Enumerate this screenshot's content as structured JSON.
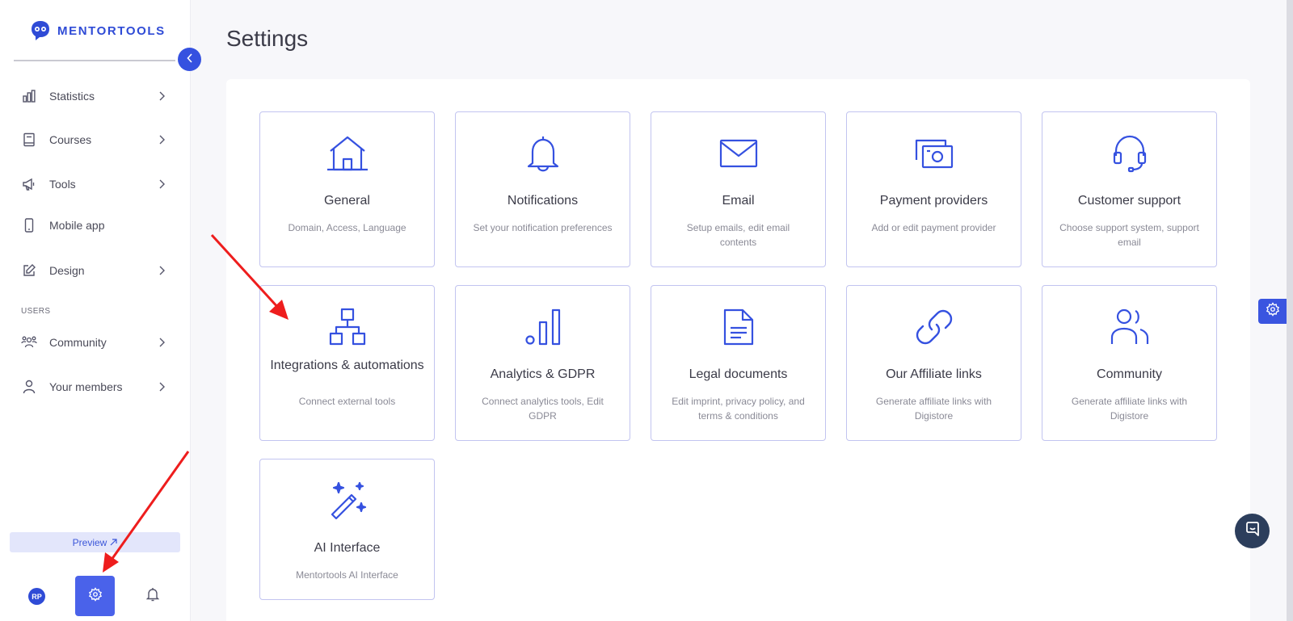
{
  "brand": {
    "name": "MENTORTOOLS",
    "accent": "#2f4bd6",
    "card_border": "#c2c4f0"
  },
  "sidebar": {
    "items": [
      {
        "label": "Statistics",
        "icon": "bar-chart-icon",
        "has_chevron": true
      },
      {
        "label": "Courses",
        "icon": "book-icon",
        "has_chevron": true
      },
      {
        "label": "Tools",
        "icon": "megaphone-icon",
        "has_chevron": true
      },
      {
        "label": "Mobile app",
        "icon": "smartphone-icon",
        "has_chevron": false
      },
      {
        "label": "Design",
        "icon": "edit-icon",
        "has_chevron": true
      }
    ],
    "section_users": "USERS",
    "user_items": [
      {
        "label": "Community",
        "icon": "people-icon",
        "has_chevron": true
      },
      {
        "label": "Your members",
        "icon": "user-icon",
        "has_chevron": true
      }
    ],
    "preview_label": "Preview",
    "avatar_initials": "RP"
  },
  "main": {
    "title": "Settings",
    "cards": [
      {
        "title": "General",
        "desc": "Domain, Access, Language",
        "icon": "house-icon"
      },
      {
        "title": "Notifications",
        "desc": "Set your notification preferences",
        "icon": "bell-icon"
      },
      {
        "title": "Email",
        "desc": "Setup emails, edit email contents",
        "icon": "envelope-icon"
      },
      {
        "title": "Payment providers",
        "desc": "Add or edit payment provider",
        "icon": "money-icon"
      },
      {
        "title": "Customer support",
        "desc": "Choose support system, support email",
        "icon": "headset-icon"
      },
      {
        "title": "Integrations & automations",
        "desc": "Connect external tools",
        "icon": "hierarchy-icon"
      },
      {
        "title": "Analytics & GDPR",
        "desc": "Connect analytics tools, Edit GDPR",
        "icon": "signal-bars-icon"
      },
      {
        "title": "Legal documents",
        "desc": "Edit imprint, privacy policy, and terms & conditions",
        "icon": "document-icon"
      },
      {
        "title": "Our Affiliate links",
        "desc": "Generate affiliate links with Digistore",
        "icon": "link-icon"
      },
      {
        "title": "Community",
        "desc": "Generate affiliate links with Digistore",
        "icon": "users-icon"
      },
      {
        "title": "AI Interface",
        "desc": "Mentortools AI Interface",
        "icon": "magic-wand-icon"
      }
    ]
  }
}
